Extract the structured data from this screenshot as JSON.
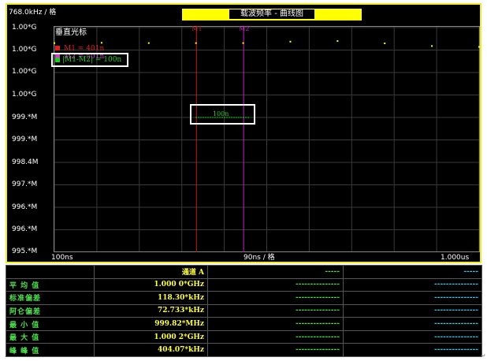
{
  "header": {
    "scale_label": "768.0kHz / 格",
    "title": "载波频率 - 曲线图"
  },
  "y_axis_labels": [
    "1.00*G",
    "1.00*G",
    "1.00*G",
    "1.00*G",
    "999.*M",
    "999.*M",
    "998.4M",
    "997.*M",
    "996.*M",
    "996.*M",
    "995.*M"
  ],
  "x_axis": {
    "left_label": "100ns",
    "center_label": "90ns / 格",
    "right_label": "1.000us"
  },
  "cursor_panel": {
    "title": "垂直光标",
    "m1_label": "M1 = 401n",
    "m2_label": "M2 = 501n",
    "diff_label": "|M1-M2| = 100n",
    "diff_readout": "100n",
    "m1_marker": "M1",
    "m2_marker": "M2"
  },
  "colors": {
    "m1": "#e02020",
    "m2": "#e030e0",
    "diff": "#20d020",
    "points": "#ffff00",
    "frame": "#f0ec20"
  },
  "chart_data": {
    "type": "scatter",
    "xlabel": "90ns / 格",
    "ylabel": "768.0kHz / 格",
    "x_unit": "ns",
    "y_unit": "GHz",
    "xlim": [
      100,
      1000
    ],
    "points": [
      {
        "x": 100,
        "y": 0.99993
      },
      {
        "x": 200,
        "y": 0.99994
      },
      {
        "x": 300,
        "y": 0.99993
      },
      {
        "x": 400,
        "y": 0.99993
      },
      {
        "x": 500,
        "y": 0.99993
      },
      {
        "x": 600,
        "y": 0.99998
      },
      {
        "x": 700,
        "y": 1.0
      },
      {
        "x": 800,
        "y": 0.99992
      },
      {
        "x": 900,
        "y": 0.99983
      },
      {
        "x": 1000,
        "y": 0.9998
      }
    ],
    "cursors": [
      {
        "name": "M1",
        "x": 401
      },
      {
        "name": "M2",
        "x": 501
      }
    ]
  },
  "stats_table": {
    "header": [
      "",
      "通道 A",
      "-----",
      "-----"
    ],
    "rows": [
      {
        "label": "平 均 值",
        "value": "1.000 0*GHz",
        "c2": "---------------",
        "c3": "---------------"
      },
      {
        "label": "标准偏差",
        "value": "118.30*kHz",
        "c2": "---------------",
        "c3": "---------------"
      },
      {
        "label": "阿仑偏差",
        "value": "72.733*kHz",
        "c2": "---------------",
        "c3": "---------------"
      },
      {
        "label": "最 小 值",
        "value": "999.82*MHz",
        "c2": "---------------",
        "c3": "---------------"
      },
      {
        "label": "最 大 值",
        "value": "1.000 2*GHz",
        "c2": "---------------",
        "c3": "---------------"
      },
      {
        "label": "峰 峰 值",
        "value": "404.07*kHz",
        "c2": "---------------",
        "c3": "---------------"
      }
    ]
  }
}
